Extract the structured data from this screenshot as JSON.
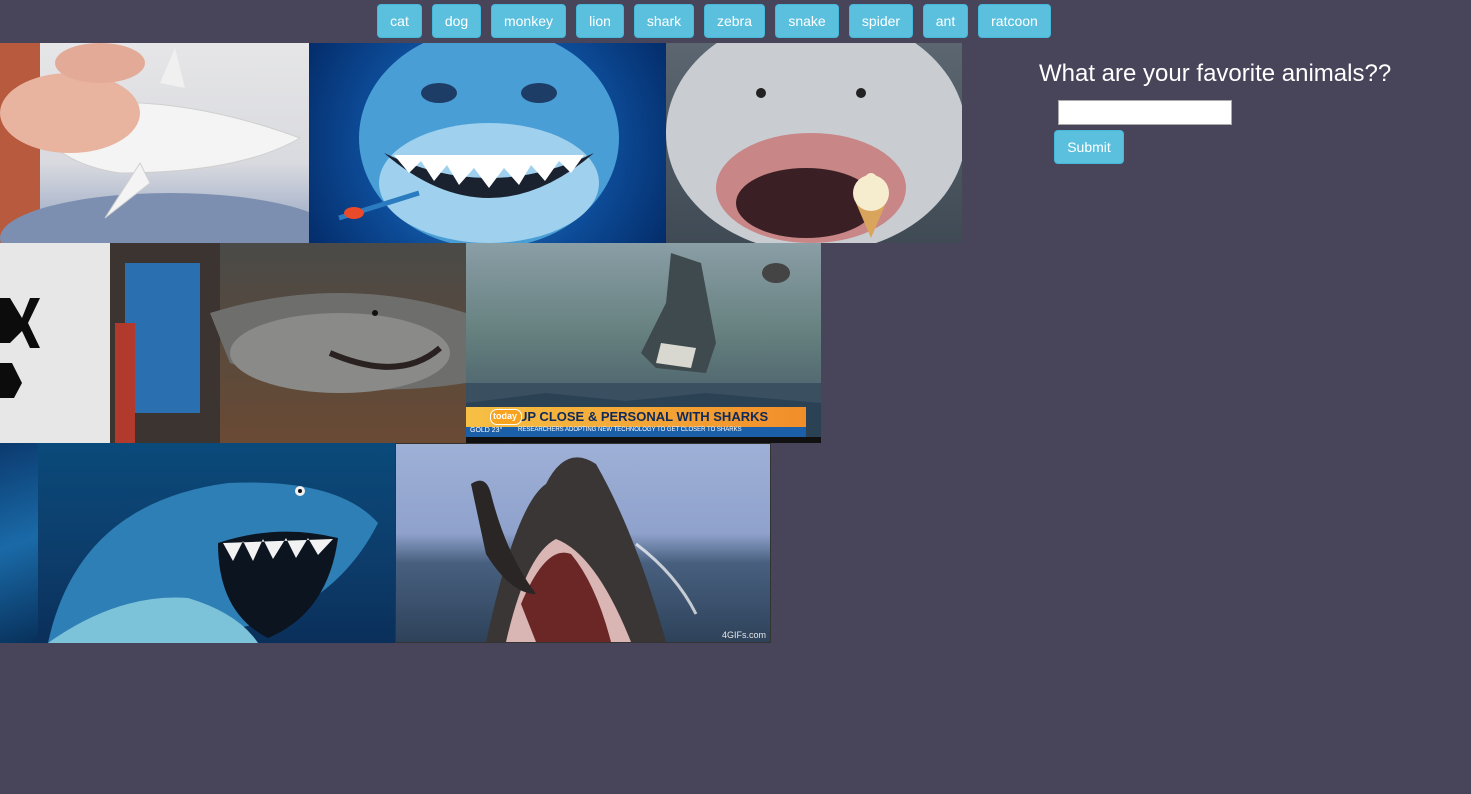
{
  "buttons": [
    "cat",
    "dog",
    "monkey",
    "lion",
    "shark",
    "zebra",
    "snake",
    "spider",
    "ant",
    "ratcoon"
  ],
  "form": {
    "title": "What are your favorite animals??",
    "input_value": "",
    "submit_label": "Submit"
  },
  "gifs": {
    "tv_banner_text": "UP CLOSE & PERSONAL WITH SHARKS",
    "tv_banner_sub": "RESEARCHERS ADOPTING NEW TECHNOLOGY TO GET CLOSER TO SHARKS",
    "tv_logo": "today",
    "tv_ticker": "GOLD 23°",
    "watermark": "4GIFs.com"
  }
}
